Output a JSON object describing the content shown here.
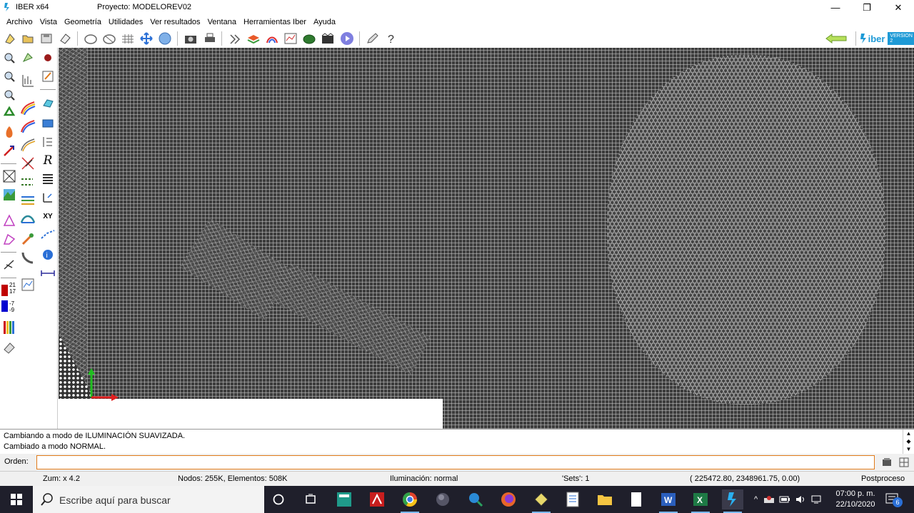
{
  "window": {
    "app_name": "IBER x64",
    "project": "Proyecto: MODELOREV02",
    "minimize": "—",
    "restore": "❐",
    "close": "✕"
  },
  "menu": [
    "Archivo",
    "Vista",
    "Geometría",
    "Utilidades",
    "Ver resultados",
    "Ventana",
    "Herramientas Iber",
    "Ayuda"
  ],
  "brand": {
    "logo_text": "iber",
    "version_badge": "VERSION 2",
    "accent": "#1e9ad6"
  },
  "left_toolbar": {
    "contour_labels": [
      "21",
      "17",
      "-7",
      "-9"
    ],
    "xy_label": "XY",
    "r_label": "R"
  },
  "messages": [
    "Cambiando a modo de  ILUMINACIÓN SUAVIZADA.",
    "Cambiado a modo NORMAL."
  ],
  "command": {
    "label": "Orden:",
    "value": ""
  },
  "status": {
    "zoom": "Zum: x 4.2",
    "nodes": "Nodos: 255K, Elementos: 508K",
    "lighting": "Iluminación: normal",
    "sets": "'Sets': 1",
    "coords": "( 225472.80,  2348961.75,  0.00)",
    "mode": "Postproceso"
  },
  "taskbar": {
    "search_placeholder": "Escribe aquí para buscar",
    "time": "07:00 p. m.",
    "date": "22/10/2020",
    "notification_count": "6"
  }
}
